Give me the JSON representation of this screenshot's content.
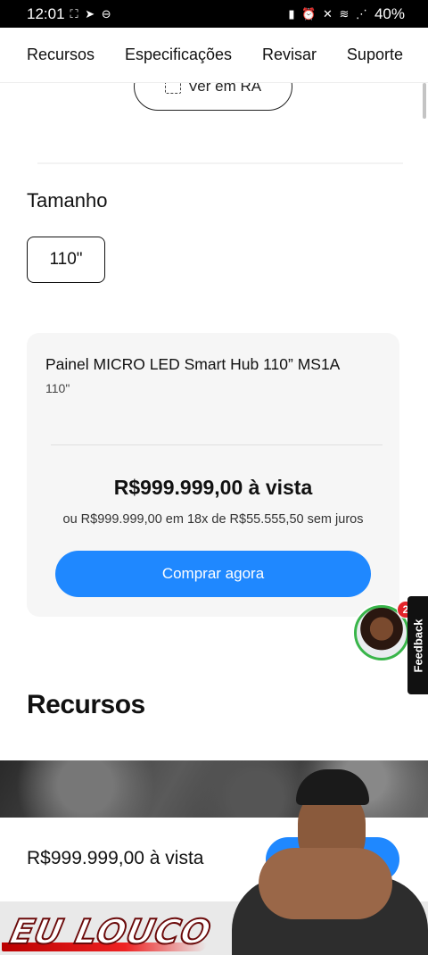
{
  "status_bar": {
    "time": "12:01",
    "left_icons": "⛶ ➤ ⊖",
    "right_icons": "▮ ⏰ ✕ ≋ ⋰",
    "battery": "40%"
  },
  "nav": {
    "tabs": [
      "Recursos",
      "Especificações",
      "Revisar",
      "Suporte"
    ]
  },
  "ar_button": {
    "label": "Ver em RA"
  },
  "size_selector": {
    "title": "Tamanho",
    "options": [
      "110\""
    ]
  },
  "product_card": {
    "title": "Painel MICRO LED Smart Hub 110” MS1A",
    "subtitle": "110\"",
    "price": "R$999.999,00 à vista",
    "installments": "ou R$999.999,00 em 18x de R$55.555,50 sem juros",
    "buy_label": "Comprar agora"
  },
  "chat_avatar": {
    "badge_count": "2"
  },
  "feedback_tab": {
    "label": "Feedback"
  },
  "section": {
    "title": "Recursos"
  },
  "sticky_bar": {
    "price": "R$999.999,00 à vista"
  },
  "watermark": {
    "text": "EU LOUCO"
  },
  "colors": {
    "accent": "#1f88ff",
    "card_bg": "#f6f6f6",
    "badge": "#e3242b",
    "avatar_ring": "#39b54a"
  }
}
